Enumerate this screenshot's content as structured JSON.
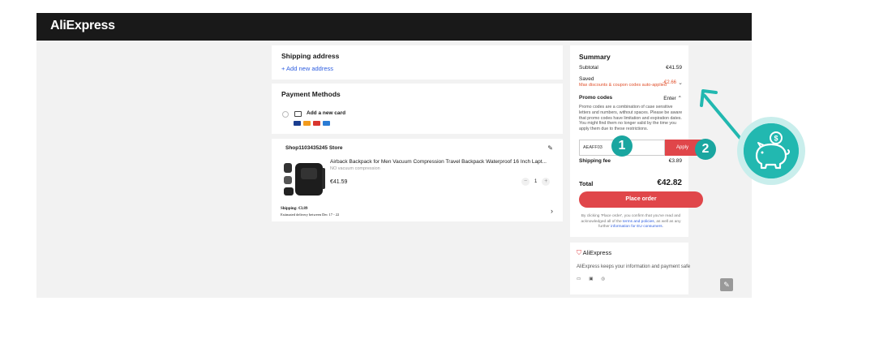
{
  "header": {
    "logo_a": "Ali",
    "logo_b": "Express"
  },
  "shipping": {
    "title": "Shipping address",
    "add_label": "+ Add new address"
  },
  "payment": {
    "title": "Payment Methods",
    "add_card_label": "Add a new card"
  },
  "store": {
    "name": "Shop1103435245 Store",
    "product_title": "Airback Backpack for Men Vacuum Compression Travel Backpack Waterproof 16 Inch Lapt...",
    "variant": "NO vacuum compression",
    "price": "€41.59",
    "quantity": "1",
    "shipping": "Shipping: €3.89",
    "delivery": "Estimated delivery between Dec 17 - 22"
  },
  "summary": {
    "title": "Summary",
    "subtotal_label": "Subtotal",
    "subtotal_value": "€41.59",
    "saved_label": "Saved",
    "saved_note": "Max discounts & coupon codes auto-applied",
    "saved_value": "-€2.66",
    "promo_label": "Promo codes",
    "promo_enter": "Enter",
    "promo_desc": "Promo codes are a combination of case sensitive letters and numbers, without spaces. Please be aware that promo codes have limitation and expiration dates. You might find them no longer valid by the time you apply them due to these restrictions.",
    "promo_input_value": "AEAFF03",
    "apply_label": "Apply",
    "shipping_label": "Shipping fee",
    "shipping_value": "€3.89",
    "total_label": "Total",
    "total_value": "€42.82",
    "place_order_label": "Place order",
    "legal_prefix": "By clicking 'Place order', you confirm that you've read and acknowledged all of the",
    "legal_terms": "terms and policies",
    "legal_mid": ", as well as any further",
    "legal_info": "information for EU consumers",
    "legal_suffix": "."
  },
  "safety": {
    "brand": "AliExpress",
    "message": "AliExpress keeps your information and payment safe"
  },
  "annotations": {
    "step1": "1",
    "step2": "2"
  },
  "colors": {
    "accent": "#e0464a",
    "teal": "#1aa6a0",
    "link": "#2e5ee0",
    "saved": "#e0502b"
  }
}
